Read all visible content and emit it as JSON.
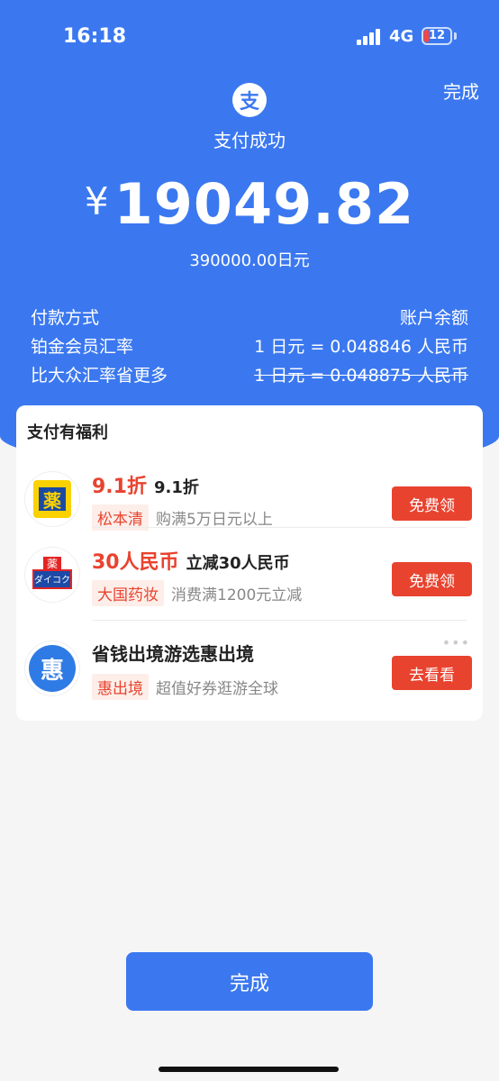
{
  "status_bar": {
    "time": "16:18",
    "network": "4G",
    "battery": "12"
  },
  "header": {
    "done_label": "完成",
    "logo_icon": "alipay-icon",
    "logo_glyph": "支",
    "success_text": "支付成功",
    "currency_symbol": "¥",
    "amount": "19049.82",
    "sub_amount": "390000.00日元"
  },
  "details": [
    {
      "label": "付款方式",
      "value": "账户余额"
    },
    {
      "label": "铂金会员汇率",
      "value": "1 日元 = 0.048846 人民币"
    },
    {
      "label": "比大众汇率省更多",
      "value": "1 日元 = 0.048875 人民币"
    }
  ],
  "benefits": {
    "title": "支付有福利",
    "items": [
      {
        "icon": "matsumoto-kiyoshi-logo",
        "icon_glyph": "薬",
        "headline": "9.1折",
        "desc": "9.1折",
        "tag": "松本清",
        "note": "购满5万日元以上",
        "button": "免费领"
      },
      {
        "icon": "daikoku-drug-logo",
        "icon_glyph_top": "薬",
        "icon_glyph_bottom": "ダイコク",
        "headline": "30人民币",
        "desc": "立减30人民币",
        "tag": "大国药妆",
        "note": "消费满1200元立减",
        "button": "免费领"
      },
      {
        "icon": "hui-chujing-logo",
        "icon_glyph": "惠",
        "headline": "省钱出境游选惠出境",
        "desc": "",
        "tag": "惠出境",
        "note": "超值好券逛游全球",
        "button": "去看看"
      }
    ]
  },
  "footer": {
    "done_label": "完成"
  },
  "colors": {
    "primary": "#3b78f0",
    "accent_red": "#e8432f",
    "background": "#f5f5f5"
  }
}
